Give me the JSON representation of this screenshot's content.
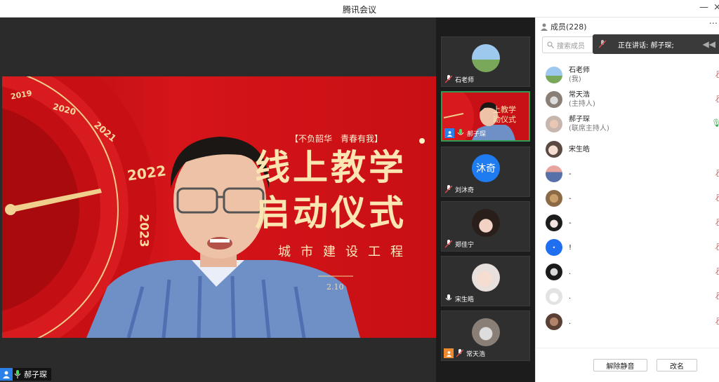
{
  "window": {
    "title": "腾讯会议",
    "minimize": "—",
    "close": "×"
  },
  "main": {
    "slide": {
      "tagline": "【不负韶华　青春有我】",
      "title_line1": "线上教学",
      "title_line2": "启动仪式",
      "subtitle": "城市建设工程",
      "date": "2.10",
      "years": [
        "2019",
        "2020",
        "2021",
        "2022",
        "2023"
      ]
    },
    "speaker_name": "郝子琛"
  },
  "thumbnails": [
    {
      "name": "石老师"
    },
    {
      "name": "郝子琛"
    },
    {
      "name": "刘沐奇",
      "avatar_text": "沐奇"
    },
    {
      "name": "郑佳宁"
    },
    {
      "name": "宋生皓"
    },
    {
      "name": "常天浩"
    }
  ],
  "panel": {
    "header": "成员(228)",
    "more": "···",
    "search_placeholder": "搜索成员",
    "speaking_toast": "正在讲话: 郝子琛;",
    "members": [
      {
        "name": "石老师",
        "role": "(我)"
      },
      {
        "name": "常天浩",
        "role": "(主持人)"
      },
      {
        "name": "郝子琛",
        "role": "(联席主持人)"
      },
      {
        "name": "宋生皓",
        "role": ""
      },
      {
        "name": "-",
        "role": ""
      },
      {
        "name": "-",
        "role": ""
      },
      {
        "name": "-",
        "role": ""
      },
      {
        "name": "!",
        "role": ""
      },
      {
        "name": ".",
        "role": ""
      },
      {
        "name": ".",
        "role": ""
      },
      {
        "name": ".",
        "role": ""
      }
    ],
    "unmute_button": "解除静音",
    "rename_button": "改名"
  },
  "colors": {
    "accent": "#2a7fe8",
    "speaking_border": "#2f9b53",
    "slide_red": "#d51519",
    "slide_gold": "#fbe6b2"
  }
}
